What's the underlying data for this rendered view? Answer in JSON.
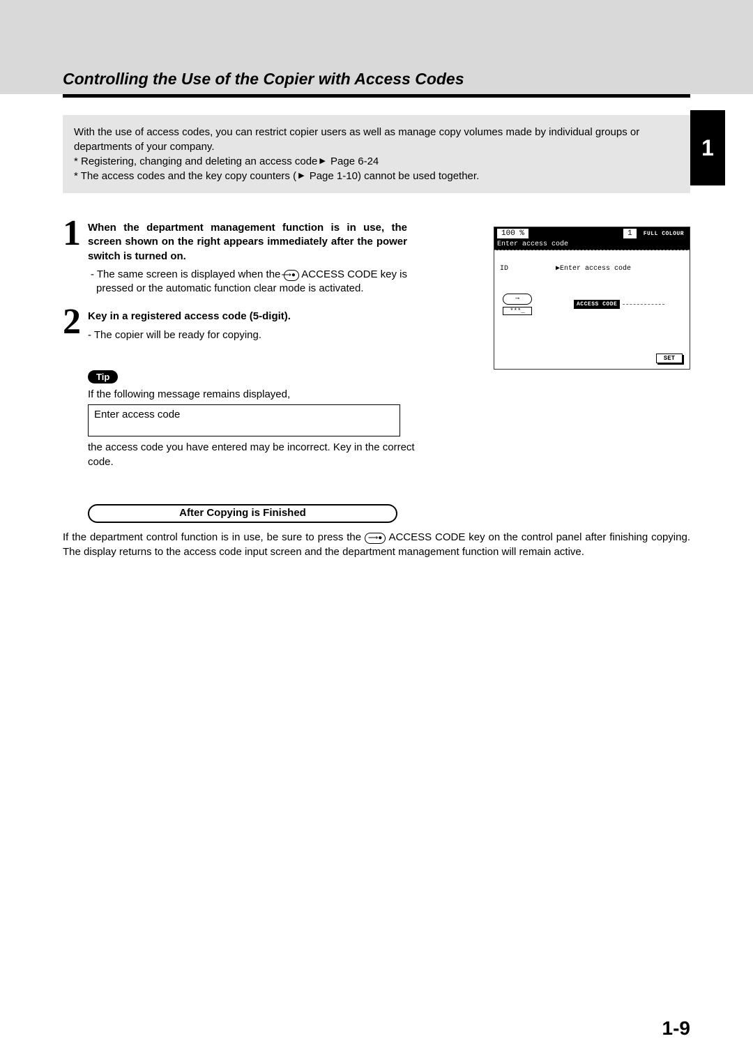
{
  "title": "Controlling the Use of the Copier with Access Codes",
  "chapter_tab": "1",
  "intro": {
    "p1": "With the use of access codes, you can restrict copier users as well as manage copy volumes made by individual groups or departments of your company.",
    "b1_pre": "* Registering, changing and deleting an access code",
    "b1_ref": " Page 6-24",
    "b2_pre": "* The access codes and the key copy counters (",
    "b2_ref": " Page 1-10",
    "b2_post": ") cannot be used together."
  },
  "step1": {
    "num": "1",
    "heading": "When the department management function is in use, the screen shown on the right appears immediately after the power switch is turned on.",
    "sub_pre": "- The same screen is displayed when the ",
    "key_glyph": "⟶●",
    "sub_post": " ACCESS CODE key is pressed or the automatic function clear mode is activated."
  },
  "step2": {
    "num": "2",
    "heading": "Key in a registered access code (5-digit).",
    "sub": "- The copier will be ready for copying."
  },
  "tip": {
    "label": "Tip",
    "line1": "If the following message remains displayed,",
    "box": "Enter access code",
    "line2": "the access code you have entered may be incorrect. Key in the correct code."
  },
  "after": {
    "heading": "After Copying is Finished",
    "text_pre": "If the department control function is in use, be sure to press the ",
    "key_glyph": "⟶●",
    "text_post": " ACCESS CODE key on the control panel after finishing copying. The display returns to the access code input screen and the department management function will remain active."
  },
  "lcd": {
    "zoom": "100 %",
    "count": "1",
    "full": "FULL COLOUR",
    "msg": "Enter access code",
    "id_label": "ID",
    "prompt": "▶Enter access code",
    "key_glyph": "⟶",
    "stars": "***_",
    "ac_label": "ACCESS CODE",
    "set": "SET"
  },
  "page_num": "1-9"
}
